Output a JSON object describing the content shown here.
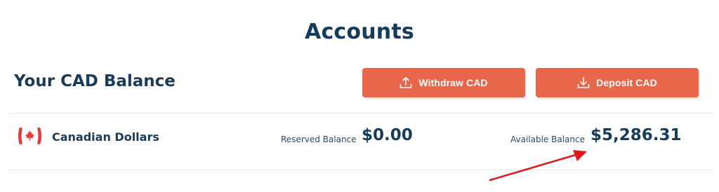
{
  "page": {
    "title": "Accounts"
  },
  "balance_section": {
    "title": "Your CAD Balance",
    "withdraw_label": "Withdraw CAD",
    "deposit_label": "Deposit CAD"
  },
  "account_row": {
    "currency_name": "Canadian Dollars",
    "flag_icon": "canada-flag-icon",
    "reserved_label": "Reserved Balance",
    "reserved_value": "$0.00",
    "available_label": "Available Balance",
    "available_value": "$5,286.31"
  },
  "colors": {
    "accent": "#e8664a",
    "heading": "#163b5c",
    "annotation_arrow": "#e0161e"
  }
}
